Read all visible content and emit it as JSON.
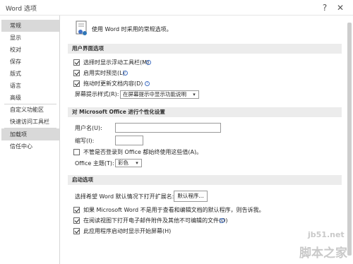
{
  "window": {
    "title": "Word 选项",
    "help_label": "?",
    "close_label": "✕"
  },
  "sidebar": {
    "items": [
      {
        "label": "常规"
      },
      {
        "label": "显示"
      },
      {
        "label": "校对"
      },
      {
        "label": "保存"
      },
      {
        "label": "版式"
      },
      {
        "label": "语言"
      },
      {
        "label": "高级"
      },
      {
        "label": "自定义功能区"
      },
      {
        "label": "快速访问工具栏"
      },
      {
        "label": "加载项"
      },
      {
        "label": "信任中心"
      }
    ]
  },
  "main": {
    "intro": "使用 Word 时采用的常规选项。",
    "ui_section": {
      "title": "用户界面选项",
      "opt1": "选择时显示浮动工具栏(M)",
      "opt2": "启用实时预览(L)",
      "opt3": "拖动时更新文档内容(D)",
      "screentip_label": "屏幕提示样式(R):",
      "screentip_value": "在屏幕提示中显示功能说明"
    },
    "personalize": {
      "title": "对 Microsoft Office 进行个性化设置",
      "username_label": "用户名(U):",
      "username_value": "",
      "initials_label": "缩写(I):",
      "initials_value": "",
      "always_use": "不管是否登录到 Office 都始终使用这些值(A)。",
      "theme_label": "Office 主题(T):",
      "theme_value": "彩色"
    },
    "startup": {
      "title": "启动选项",
      "ext_label": "选择希望 Word 默认情况下打开扩展名:",
      "default_programs_button": "默认程序...",
      "opt_tell": "如果 Microsoft Word 不是用于查看和编辑文档的默认程序，则告诉我。",
      "opt_reading": "在阅读视图下打开电子邮件附件及其他不可编辑的文件(O)",
      "opt_startscreen": "此应用程序启动时显示开始屏幕(H)"
    }
  },
  "watermark": {
    "site": "jb51.net",
    "brand": "脚本之家"
  },
  "colors": {
    "accent": "#4472c4",
    "section_bg": "#ececec",
    "nav_active_bg": "#d9d9d9"
  }
}
